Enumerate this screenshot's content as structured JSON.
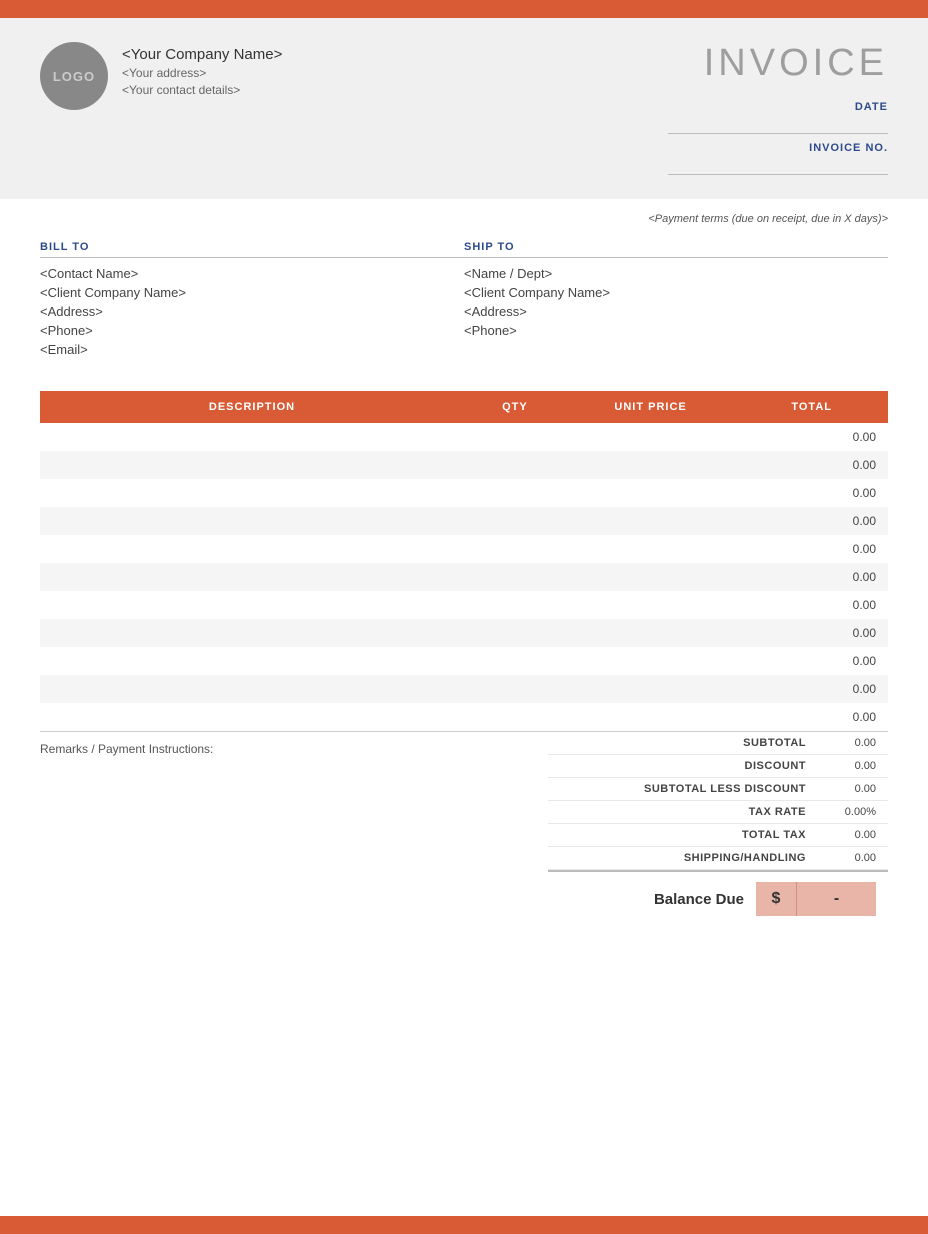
{
  "colors": {
    "accent": "#d95b35",
    "header_bg": "#f0f0f0",
    "label_blue": "#2d4a8a",
    "balance_bg": "#e8b5a8"
  },
  "header": {
    "logo_text": "LOGO",
    "company_name": "<Your Company Name>",
    "company_address": "<Your address>",
    "company_contact": "<Your contact details>",
    "invoice_title": "INVOICE",
    "date_label": "DATE",
    "date_value": "",
    "invoice_no_label": "INVOICE NO.",
    "invoice_no_value": ""
  },
  "payment_terms": "<Payment terms (due on receipt, due in X days)>",
  "bill_to": {
    "label": "BILL TO",
    "contact": "<Contact Name>",
    "company": "<Client Company Name>",
    "address": "<Address>",
    "phone": "<Phone>",
    "email": "<Email>"
  },
  "ship_to": {
    "label": "SHIP TO",
    "name_dept": "<Name / Dept>",
    "company": "<Client Company Name>",
    "address": "<Address>",
    "phone": "<Phone>"
  },
  "table": {
    "headers": {
      "description": "DESCRIPTION",
      "qty": "QTY",
      "unit_price": "UNIT PRICE",
      "total": "TOTAL"
    },
    "rows": [
      {
        "description": "",
        "qty": "",
        "unit_price": "",
        "total": "0.00"
      },
      {
        "description": "",
        "qty": "",
        "unit_price": "",
        "total": "0.00"
      },
      {
        "description": "",
        "qty": "",
        "unit_price": "",
        "total": "0.00"
      },
      {
        "description": "",
        "qty": "",
        "unit_price": "",
        "total": "0.00"
      },
      {
        "description": "",
        "qty": "",
        "unit_price": "",
        "total": "0.00"
      },
      {
        "description": "",
        "qty": "",
        "unit_price": "",
        "total": "0.00"
      },
      {
        "description": "",
        "qty": "",
        "unit_price": "",
        "total": "0.00"
      },
      {
        "description": "",
        "qty": "",
        "unit_price": "",
        "total": "0.00"
      },
      {
        "description": "",
        "qty": "",
        "unit_price": "",
        "total": "0.00"
      },
      {
        "description": "",
        "qty": "",
        "unit_price": "",
        "total": "0.00"
      },
      {
        "description": "",
        "qty": "",
        "unit_price": "",
        "total": "0.00"
      }
    ]
  },
  "remarks_label": "Remarks / Payment Instructions:",
  "totals": {
    "subtotal_label": "SUBTOTAL",
    "subtotal_value": "0.00",
    "discount_label": "DISCOUNT",
    "discount_value": "0.00",
    "subtotal_less_discount_label": "SUBTOTAL LESS DISCOUNT",
    "subtotal_less_discount_value": "0.00",
    "tax_rate_label": "TAX RATE",
    "tax_rate_value": "0.00%",
    "total_tax_label": "TOTAL TAX",
    "total_tax_value": "0.00",
    "shipping_label": "SHIPPING/HANDLING",
    "shipping_value": "0.00"
  },
  "balance_due": {
    "label": "Balance Due",
    "currency_symbol": "$",
    "amount": "-"
  }
}
